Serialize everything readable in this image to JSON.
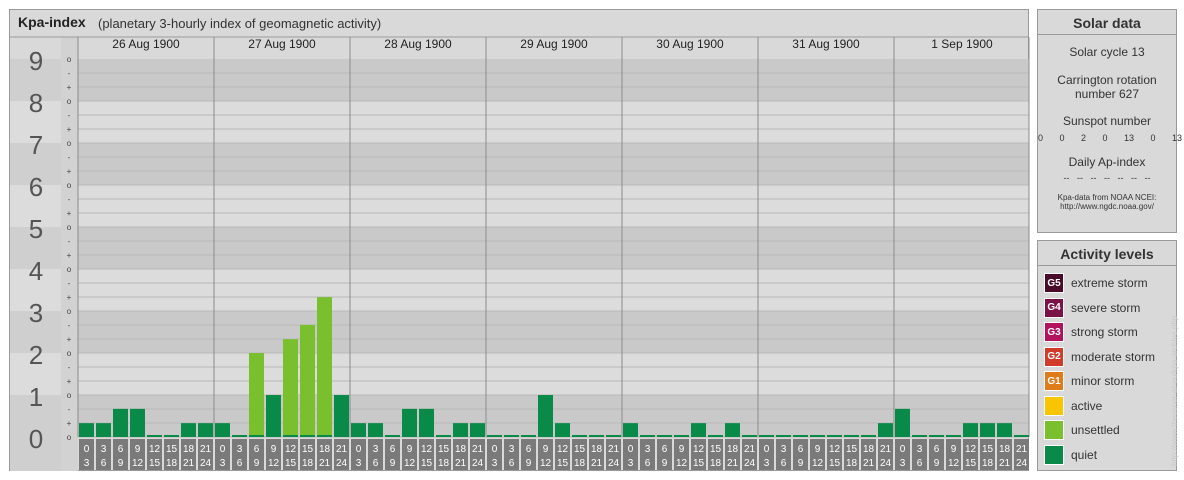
{
  "header": {
    "title": "Kpa-index",
    "subtitle": "(planetary 3-hourly index of geomagnetic activity)"
  },
  "colors": {
    "quiet": "#0a8a49",
    "unsettled": "#79bf2e",
    "active": "#f7c600",
    "minor": "#e07b1a",
    "moderate": "#d13c2a",
    "strong": "#b3135c",
    "severe": "#7a1248",
    "extreme": "#4a0a2a"
  },
  "chart_data": {
    "type": "bar",
    "ylim": [
      0,
      9
    ],
    "y_ticks": [
      "0",
      "1",
      "2",
      "3",
      "4",
      "5",
      "6",
      "7",
      "8",
      "9"
    ],
    "sub_ticks": [
      "o",
      "+",
      "-"
    ],
    "days": [
      "26 Aug 1900",
      "27 Aug 1900",
      "28 Aug 1900",
      "29 Aug 1900",
      "30 Aug 1900",
      "31 Aug 1900",
      "1 Sep 1900"
    ],
    "interval_labels": [
      [
        "0",
        "3"
      ],
      [
        "3",
        "6"
      ],
      [
        "6",
        "9"
      ],
      [
        "9",
        "12"
      ],
      [
        "12",
        "15"
      ],
      [
        "15",
        "18"
      ],
      [
        "18",
        "21"
      ],
      [
        "21",
        "24"
      ]
    ],
    "values": [
      [
        0.33,
        0.33,
        0.67,
        0.67,
        0,
        0,
        0.33,
        0.33
      ],
      [
        0.33,
        0,
        2,
        1,
        2.33,
        2.67,
        3.33,
        1
      ],
      [
        0.33,
        0.33,
        0,
        0.67,
        0.67,
        0,
        0.33,
        0.33
      ],
      [
        0,
        0,
        0,
        1,
        0.33,
        0,
        0,
        0
      ],
      [
        0.33,
        0,
        0,
        0,
        0.33,
        0,
        0.33,
        0
      ],
      [
        0,
        0,
        0,
        0,
        0,
        0,
        0,
        0.33
      ],
      [
        0.67,
        0,
        0,
        0,
        0.33,
        0.33,
        0.33,
        0
      ]
    ]
  },
  "solar": {
    "title": "Solar data",
    "cycle": "Solar cycle 13",
    "carrington_1": "Carrington rotation",
    "carrington_2": "number 627",
    "sunspot_label": "Sunspot number",
    "sunspot_values": "0   0   2   0   13   0   13",
    "ap_label": "Daily Ap-index",
    "ap_values": "--   --   --   --   --   --   --",
    "source_1": "Kpa-data from NOAA NCEI:",
    "source_2": "http://www.ngdc.noaa.gov/"
  },
  "activity": {
    "title": "Activity levels",
    "levels": [
      {
        "badge": "G5",
        "label": "extreme storm",
        "color": "#4a0a2a"
      },
      {
        "badge": "G4",
        "label": "severe storm",
        "color": "#7a1248"
      },
      {
        "badge": "G3",
        "label": "strong storm",
        "color": "#b3135c"
      },
      {
        "badge": "G2",
        "label": "moderate storm",
        "color": "#d13c2a"
      },
      {
        "badge": "G1",
        "label": "minor storm",
        "color": "#e07b1a"
      },
      {
        "badge": "",
        "label": "active",
        "color": "#f7c600"
      },
      {
        "badge": "",
        "label": "unsettled",
        "color": "#79bf2e"
      },
      {
        "badge": "",
        "label": "quiet",
        "color": "#0a8a49"
      }
    ]
  },
  "credit": "http://www.theusner-at-eu/kpa-archive.php"
}
